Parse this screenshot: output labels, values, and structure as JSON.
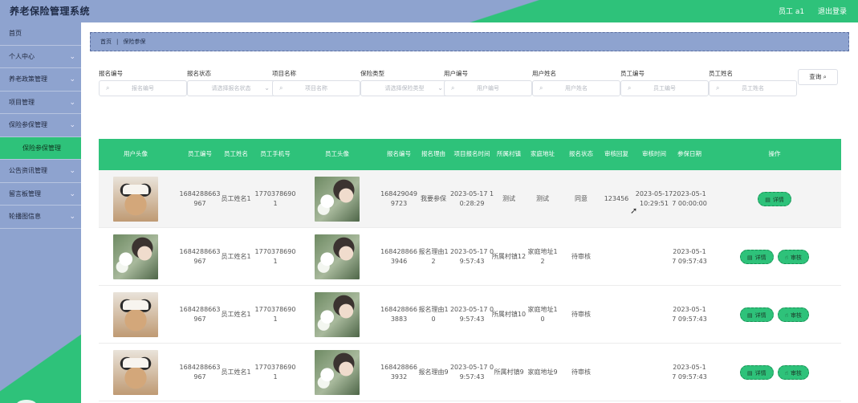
{
  "app": {
    "title": "养老保险管理系统"
  },
  "header": {
    "user": "员工 a1",
    "logout": "退出登录"
  },
  "sidebar": {
    "items": [
      {
        "label": "首页",
        "chevron": false,
        "sub": false
      },
      {
        "label": "个人中心",
        "chevron": true,
        "sub": false
      },
      {
        "label": "养老政策管理",
        "chevron": true,
        "sub": false
      },
      {
        "label": "项目管理",
        "chevron": true,
        "sub": false
      },
      {
        "label": "保险参保管理",
        "chevron": true,
        "sub": false
      },
      {
        "label": "保险参保管理",
        "chevron": false,
        "sub": true
      },
      {
        "label": "公告资讯管理",
        "chevron": true,
        "sub": false
      },
      {
        "label": "留言板管理",
        "chevron": true,
        "sub": false
      },
      {
        "label": "轮播图信息",
        "chevron": true,
        "sub": false
      }
    ]
  },
  "breadcrumb": {
    "home": "首页",
    "sep": "|",
    "current": "保险参保"
  },
  "filters": {
    "fields": [
      {
        "label": "报名编号",
        "placeholder": "报名编号",
        "type": "input"
      },
      {
        "label": "报名状态",
        "placeholder": "请选择报名状态",
        "type": "select"
      },
      {
        "label": "项目名称",
        "placeholder": "项目名称",
        "type": "input"
      },
      {
        "label": "保险类型",
        "placeholder": "请选择保险类型",
        "type": "select"
      },
      {
        "label": "用户编号",
        "placeholder": "用户编号",
        "type": "input"
      },
      {
        "label": "用户姓名",
        "placeholder": "用户姓名",
        "type": "input"
      },
      {
        "label": "员工编号",
        "placeholder": "员工编号",
        "type": "input"
      },
      {
        "label": "员工姓名",
        "placeholder": "员工姓名",
        "type": "input"
      }
    ],
    "search_label": "查询"
  },
  "table": {
    "headers": [
      "用户头像",
      "员工编号",
      "员工姓名",
      "员工手机号",
      "员工头像",
      "报名编号",
      "报名理由",
      "项目报名时间",
      "所属村镇",
      "家庭地址",
      "报名状态",
      "审核回复",
      "审核时间",
      "参保日期",
      "操作"
    ],
    "detail_label": "详情",
    "audit_label": "审核",
    "rows": [
      {
        "user_avatar": "cat",
        "emp_no": "1684288663967",
        "emp_name": "员工姓名1",
        "emp_phone": "17703786901",
        "emp_avatar": "girl",
        "reg_no": "1684290499723",
        "reason": "我要参保",
        "reg_time": "2023-05-17 10:28:29",
        "village": "测试",
        "address": "测试",
        "status": "同意",
        "reply": "123456",
        "audit_time": "2023-05-17 10:29:51",
        "insure_date": "2023-05-17 00:00:00",
        "audit_btn": false
      },
      {
        "user_avatar": "girl",
        "emp_no": "1684288663967",
        "emp_name": "员工姓名1",
        "emp_phone": "17703786901",
        "emp_avatar": "girl",
        "reg_no": "1684288663946",
        "reason": "报名理由12",
        "reg_time": "2023-05-17 09:57:43",
        "village": "所属村镇12",
        "address": "家庭地址12",
        "status": "待审核",
        "reply": "",
        "audit_time": "",
        "insure_date": "2023-05-17 09:57:43",
        "audit_btn": true
      },
      {
        "user_avatar": "cat",
        "emp_no": "1684288663967",
        "emp_name": "员工姓名1",
        "emp_phone": "17703786901",
        "emp_avatar": "girl",
        "reg_no": "1684288663883",
        "reason": "报名理由10",
        "reg_time": "2023-05-17 09:57:43",
        "village": "所属村镇10",
        "address": "家庭地址10",
        "status": "待审核",
        "reply": "",
        "audit_time": "",
        "insure_date": "2023-05-17 09:57:43",
        "audit_btn": true
      },
      {
        "user_avatar": "cat",
        "emp_no": "1684288663967",
        "emp_name": "员工姓名1",
        "emp_phone": "17703786901",
        "emp_avatar": "girl",
        "reg_no": "1684288663932",
        "reason": "报名理由9",
        "reg_time": "2023-05-17 09:57:43",
        "village": "所属村镇9",
        "address": "家庭地址9",
        "status": "待审核",
        "reply": "",
        "audit_time": "",
        "insure_date": "2023-05-17 09:57:43",
        "audit_btn": true
      }
    ]
  },
  "colors": {
    "accent": "#2ec27a",
    "sidebar": "#8ea3cf"
  },
  "icons": {
    "search": "search-icon",
    "chevron": "chevron-down-icon",
    "detail": "document-icon",
    "audit": "thumb-up-icon"
  }
}
